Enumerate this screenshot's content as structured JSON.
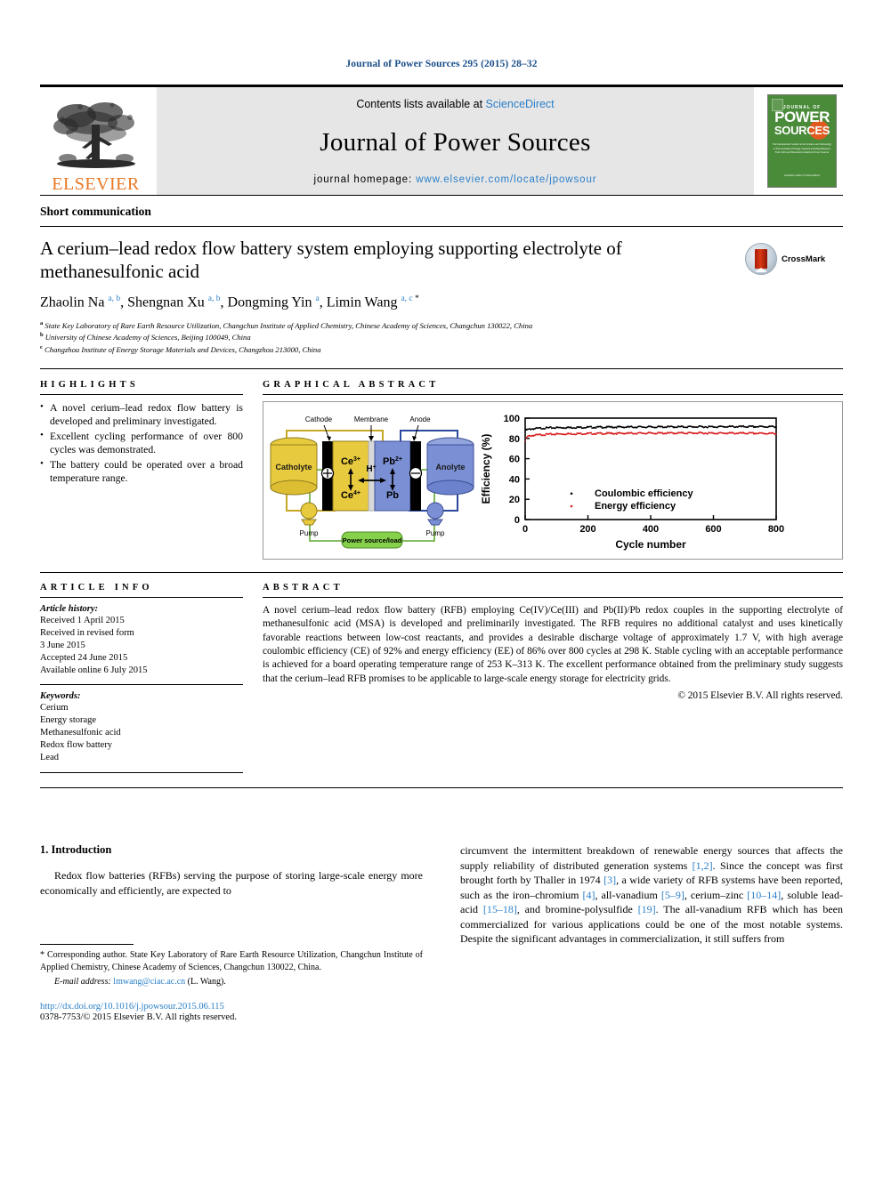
{
  "running_head": "Journal of Power Sources 295 (2015) 28–32",
  "masthead": {
    "contents_prefix": "Contents lists available at ",
    "sciencedirect": "ScienceDirect",
    "journal_title": "Journal of Power Sources",
    "homepage_prefix": "journal homepage: ",
    "homepage_url": "www.elsevier.com/locate/jpowsour",
    "publisher": "ELSEVIER",
    "cover": {
      "top_small": "ELSEVIER",
      "journal_of": "JOURNAL OF",
      "power": "POWER",
      "sources": "SOURCES",
      "description": "The International Journal on the Science and Technology of Electrochemical Energy Systems including Batteries, Fuel Cells and Photoelectrochemical Power Sources",
      "bottom": "Available online at\nScienceDirect"
    }
  },
  "article": {
    "type": "Short communication",
    "title": "A cerium–lead redox flow battery system employing supporting electrolyte of methanesulfonic acid",
    "crossmark_label": "CrossMark",
    "authors": [
      {
        "name": "Zhaolin Na",
        "marks": "a, b",
        "star": false
      },
      {
        "name": "Shengnan Xu",
        "marks": "a, b",
        "star": false
      },
      {
        "name": "Dongming Yin",
        "marks": "a",
        "star": false
      },
      {
        "name": "Limin Wang",
        "marks": "a, c",
        "star": true
      }
    ],
    "affiliations": [
      {
        "label": "a",
        "text": "State Key Laboratory of Rare Earth Resource Utilization, Changchun Institute of Applied Chemistry, Chinese Academy of Sciences, Changchun 130022, China"
      },
      {
        "label": "b",
        "text": "University of Chinese Academy of Sciences, Beijing 100049, China"
      },
      {
        "label": "c",
        "text": "Changzhou Institute of Energy Storage Materials and Devices, Changzhou 213000, China"
      }
    ]
  },
  "highlights": {
    "heading": "HIGHLIGHTS",
    "items": [
      "A novel cerium–lead redox flow battery is developed and preliminary investigated.",
      "Excellent cycling performance of over 800 cycles was demonstrated.",
      "The battery could be operated over a broad temperature range."
    ]
  },
  "graphical_abstract": {
    "heading": "GRAPHICAL ABSTRACT",
    "diagram": {
      "cathode_label": "Cathode",
      "membrane_label": "Membrane",
      "anode_label": "Anode",
      "catholyte_label": "Catholyte",
      "anolyte_label": "Anolyte",
      "left_species_top": "Ce",
      "left_species_top_sup": "3+",
      "left_species_bottom": "Ce",
      "left_species_bottom_sup": "4+",
      "proton": "H",
      "proton_sup": "+",
      "right_species_top": "Pb",
      "right_species_top_sup": "2+",
      "right_species_bottom": "Pb",
      "pump_left": "Pump",
      "pump_right": "Pump",
      "power_source": "Power source/load",
      "positive_terminal": "⊕",
      "negative_terminal": "⊖",
      "colors": {
        "catholyte": "#e8ca3e",
        "anolyte": "#7b8fd4",
        "electrode": "#000000",
        "membrane": "#d9d9d9",
        "power_box": "#86d14b",
        "wire_left": "#c9a726",
        "wire_right": "#2b4a9e",
        "wire_green": "#5fa832"
      }
    }
  },
  "chart_data": {
    "type": "scatter",
    "title": "",
    "xlabel": "Cycle number",
    "ylabel": "Efficiency (%)",
    "xlim": [
      0,
      800
    ],
    "ylim": [
      0,
      100
    ],
    "xticks": [
      0,
      200,
      400,
      600,
      800
    ],
    "yticks": [
      0,
      20,
      40,
      60,
      80,
      100
    ],
    "grid": false,
    "legend_position": "inside-lower-center",
    "series": [
      {
        "name": "Coulombic efficiency",
        "color": "#000000",
        "x": [
          1,
          5,
          10,
          20,
          40,
          60,
          80,
          100,
          150,
          200,
          250,
          300,
          350,
          400,
          450,
          500,
          550,
          600,
          650,
          700,
          750,
          800
        ],
        "y": [
          88.5,
          88.8,
          89.2,
          89.8,
          90.3,
          90.6,
          90.9,
          91.0,
          91.2,
          91.4,
          91.5,
          91.6,
          91.7,
          91.7,
          91.8,
          91.8,
          91.9,
          91.9,
          92.0,
          92.0,
          92.0,
          92.0
        ]
      },
      {
        "name": "Energy efficiency",
        "color": "#d81c1c",
        "x": [
          1,
          5,
          10,
          20,
          40,
          60,
          80,
          100,
          150,
          200,
          250,
          300,
          350,
          400,
          450,
          500,
          550,
          600,
          650,
          700,
          750,
          800
        ],
        "y": [
          78.0,
          81.5,
          82.5,
          83.2,
          83.8,
          84.2,
          84.5,
          84.7,
          85.0,
          85.2,
          85.3,
          85.4,
          85.5,
          85.6,
          85.6,
          85.7,
          85.7,
          85.6,
          85.6,
          85.5,
          85.4,
          85.3
        ]
      }
    ]
  },
  "article_info": {
    "heading": "ARTICLE INFO",
    "history_label": "Article history:",
    "history": [
      "Received 1 April 2015",
      "Received in revised form",
      "3 June 2015",
      "Accepted 24 June 2015",
      "Available online 6 July 2015"
    ],
    "keywords_label": "Keywords:",
    "keywords": [
      "Cerium",
      "Energy storage",
      "Methanesulfonic acid",
      "Redox flow battery",
      "Lead"
    ]
  },
  "abstract": {
    "heading": "ABSTRACT",
    "text": "A novel cerium–lead redox flow battery (RFB) employing Ce(IV)/Ce(III) and Pb(II)/Pb redox couples in the supporting electrolyte of methanesulfonic acid (MSA) is developed and preliminarily investigated. The RFB requires no additional catalyst and uses kinetically favorable reactions between low-cost reactants, and provides a desirable discharge voltage of approximately 1.7 V, with high average coulombic efficiency (CE) of 92% and energy efficiency (EE) of 86% over 800 cycles at 298 K. Stable cycling with an acceptable performance is achieved for a board operating temperature range of 253 K–313 K. The excellent performance obtained from the preliminary study suggests that the cerium–lead RFB promises to be applicable to large-scale energy storage for electricity grids.",
    "copyright": "© 2015 Elsevier B.V. All rights reserved."
  },
  "body": {
    "section_number_title": "1. Introduction",
    "left_paragraph": "Redox flow batteries (RFBs) serving the purpose of storing large-scale energy more economically and efficiently, are expected to",
    "right_paragraph_parts": [
      {
        "t": "circumvent the intermittent breakdown of renewable energy sources that affects the supply reliability of distributed generation systems "
      },
      {
        "t": "[1,2]",
        "ref": true
      },
      {
        "t": ". Since the concept was first brought forth by Thaller in 1974 "
      },
      {
        "t": "[3]",
        "ref": true
      },
      {
        "t": ", a wide variety of RFB systems have been reported, such as the iron–chromium "
      },
      {
        "t": "[4]",
        "ref": true
      },
      {
        "t": ", all-vanadium "
      },
      {
        "t": "[5–9]",
        "ref": true
      },
      {
        "t": ", cerium–zinc "
      },
      {
        "t": "[10–14]",
        "ref": true
      },
      {
        "t": ", soluble lead-acid "
      },
      {
        "t": "[15–18]",
        "ref": true
      },
      {
        "t": ", and bromine-polysulfide "
      },
      {
        "t": "[19]",
        "ref": true
      },
      {
        "t": ". The all-vanadium RFB which has been commercialized for various applications could be one of the most notable systems. Despite the significant advantages in commercialization, it still suffers from"
      }
    ]
  },
  "footer": {
    "corresponding_star": "*",
    "corresponding": "Corresponding author. State Key Laboratory of Rare Earth Resource Utilization, Changchun Institute of Applied Chemistry, Chinese Academy of Sciences, Changchun 130022, China.",
    "email_label": "E-mail address:",
    "email": "lmwang@ciac.ac.cn",
    "email_owner": "(L. Wang).",
    "doi": "http://dx.doi.org/10.1016/j.jpowsour.2015.06.115",
    "issn": "0378-7753/© 2015 Elsevier B.V. All rights reserved."
  }
}
